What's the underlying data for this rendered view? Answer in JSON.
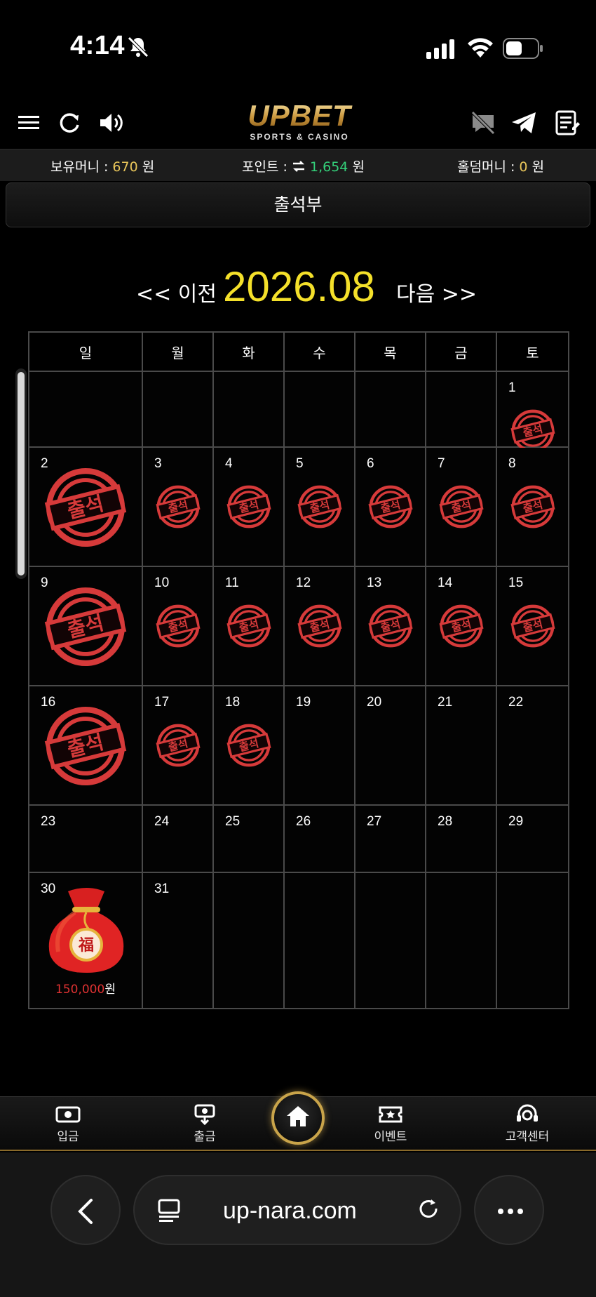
{
  "status_bar": {
    "time": "4:14"
  },
  "top_nav": {
    "logo_text": "UPBET",
    "logo_sub": "SPORTS & CASINO"
  },
  "info_bar": {
    "money_label": "보유머니 :",
    "money_value": "670",
    "money_unit": "원",
    "point_label": "포인트 :",
    "point_value": "1,654",
    "point_unit": "원",
    "holdem_label": "홀덤머니 :",
    "holdem_value": "0",
    "holdem_unit": "원"
  },
  "page_title": "출석부",
  "month_nav": {
    "prev_label": "<< 이전",
    "month": "2026.08",
    "next_label": "다음 >>"
  },
  "calendar": {
    "weekdays": [
      "일",
      "월",
      "화",
      "수",
      "목",
      "금",
      "토"
    ],
    "stamp_text": "출석",
    "weeks": [
      [
        null,
        null,
        null,
        null,
        null,
        null,
        {
          "day": 1,
          "stamp": "small"
        }
      ],
      [
        {
          "day": 2,
          "stamp": "large"
        },
        {
          "day": 3,
          "stamp": "small"
        },
        {
          "day": 4,
          "stamp": "small"
        },
        {
          "day": 5,
          "stamp": "small"
        },
        {
          "day": 6,
          "stamp": "small"
        },
        {
          "day": 7,
          "stamp": "small"
        },
        {
          "day": 8,
          "stamp": "small"
        }
      ],
      [
        {
          "day": 9,
          "stamp": "large"
        },
        {
          "day": 10,
          "stamp": "small"
        },
        {
          "day": 11,
          "stamp": "small"
        },
        {
          "day": 12,
          "stamp": "small"
        },
        {
          "day": 13,
          "stamp": "small"
        },
        {
          "day": 14,
          "stamp": "small"
        },
        {
          "day": 15,
          "stamp": "small"
        }
      ],
      [
        {
          "day": 16,
          "stamp": "large"
        },
        {
          "day": 17,
          "stamp": "small"
        },
        {
          "day": 18,
          "stamp": "small"
        },
        {
          "day": 19
        },
        {
          "day": 20
        },
        {
          "day": 21
        },
        {
          "day": 22
        }
      ],
      [
        {
          "day": 23
        },
        {
          "day": 24
        },
        {
          "day": 25
        },
        {
          "day": 26
        },
        {
          "day": 27
        },
        {
          "day": 28
        },
        {
          "day": 29
        }
      ],
      [
        {
          "day": 30,
          "reward": {
            "amount": "150,000",
            "unit": "원"
          }
        },
        {
          "day": 31
        },
        null,
        null,
        null,
        null,
        null
      ]
    ]
  },
  "tab_bar": {
    "tabs": [
      {
        "label": "입금",
        "icon": "deposit-icon"
      },
      {
        "label": "출금",
        "icon": "withdraw-icon"
      },
      {
        "label": "이벤트",
        "icon": "event-ticket-icon"
      },
      {
        "label": "고객센터",
        "icon": "support-icon"
      }
    ],
    "home_icon": "home-icon"
  },
  "browser": {
    "url": "up-nara.com"
  },
  "colors": {
    "accent_gold": "#c9a44a",
    "money_yellow": "#e8c55a",
    "point_green": "#34d07a",
    "stamp_red": "#d63a3a",
    "month_yellow": "#f4e02a"
  }
}
